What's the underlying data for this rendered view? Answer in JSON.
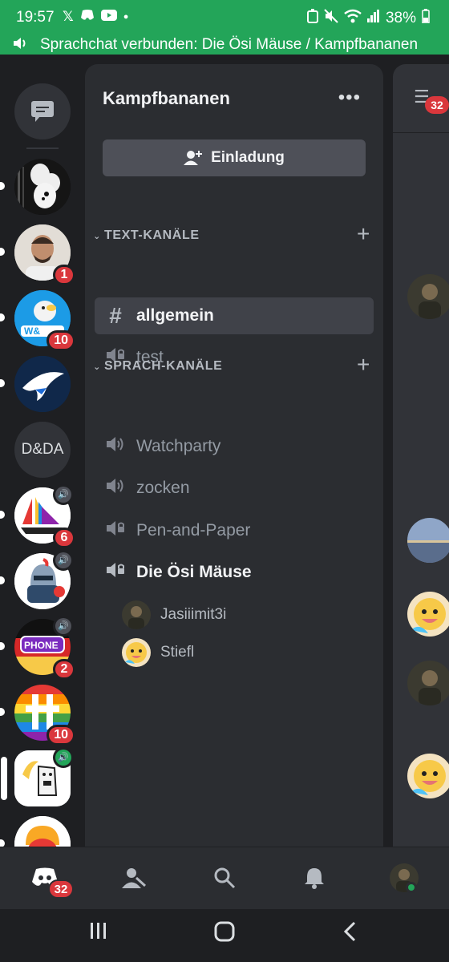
{
  "status_bar": {
    "time": "19:57",
    "battery": "38%"
  },
  "voice_banner": {
    "text": "Sprachchat verbunden: Die Ösi Mäuse / Kampfbananen"
  },
  "server_rail": {
    "servers": [
      {
        "name": "dm-button",
        "badge": ""
      },
      {
        "name": "mouse-server",
        "badge": ""
      },
      {
        "name": "person-server",
        "badge": "1"
      },
      {
        "name": "dodo-server",
        "badge": "10"
      },
      {
        "name": "eagle-server",
        "badge": ""
      },
      {
        "name": "D&DA",
        "badge": ""
      },
      {
        "name": "sailboat-server",
        "badge": "6"
      },
      {
        "name": "knight-server",
        "badge": ""
      },
      {
        "name": "gartic-phone-server",
        "badge": "2"
      },
      {
        "name": "rainbow-server",
        "badge": "10"
      },
      {
        "name": "banana-server",
        "badge": ""
      },
      {
        "name": "helmet-server",
        "badge": ""
      }
    ],
    "dda_label": "D&DA",
    "gartic_label": "PHONE"
  },
  "channel_panel": {
    "server_name": "Kampfbananen",
    "invite_label": "Einladung",
    "text_category": "TEXT-KANÄLE",
    "voice_category": "SPRACH-KANÄLE",
    "text_channels": [
      {
        "name": "allgemein",
        "icon": "hash-icon"
      },
      {
        "name": "test",
        "icon": "speaker-lock-icon"
      }
    ],
    "voice_channels": [
      {
        "name": "Watchparty",
        "icon": "speaker-icon"
      },
      {
        "name": "zocken",
        "icon": "speaker-icon"
      },
      {
        "name": "Pen-and-Paper",
        "icon": "speaker-lock-icon"
      },
      {
        "name": "Die Ösi Mäuse",
        "icon": "speaker-lock-icon"
      }
    ],
    "voice_members": [
      {
        "name": "Jasiiimit3i"
      },
      {
        "name": "Stiefl"
      }
    ]
  },
  "chat_peek": {
    "unread_count": "32"
  },
  "bottom_nav": {
    "home_badge": "32"
  },
  "colors": {
    "accent_green": "#23a559",
    "badge_red": "#da373c",
    "panel_bg": "#2b2d31"
  }
}
